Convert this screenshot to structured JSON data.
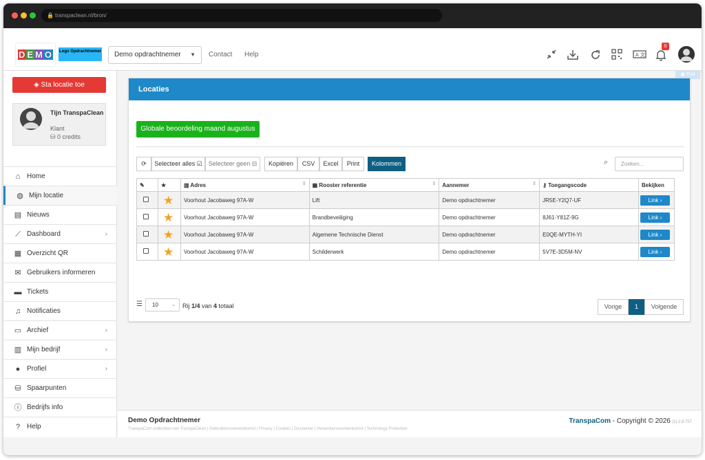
{
  "browser": {
    "url": "transpaclean.nl/bron/"
  },
  "header": {
    "logo_demo": "DEMO",
    "logo_opd": "Logo Opdrachtnemer",
    "company_select": "Demo opdrachtnemer",
    "nav": [
      "Contact",
      "Help"
    ],
    "notification_count": "0"
  },
  "sidebar": {
    "add_location_label": "Sta locatie toe",
    "profile": {
      "name": "Tijn TranspaClean",
      "role": "Klant",
      "credits": "0 credits"
    },
    "items": [
      {
        "label": "Home",
        "icon": "home-icon"
      },
      {
        "label": "Mijn locatie",
        "icon": "globe-icon"
      },
      {
        "label": "Nieuws",
        "icon": "news-icon"
      },
      {
        "label": "Dashboard",
        "icon": "chart-icon"
      },
      {
        "label": "Overzicht QR",
        "icon": "qr-icon"
      },
      {
        "label": "Gebruikers informeren",
        "icon": "envelope-icon"
      },
      {
        "label": "Tickets",
        "icon": "comment-icon"
      },
      {
        "label": "Notificaties",
        "icon": "bell-icon"
      },
      {
        "label": "Archief",
        "icon": "archive-icon"
      },
      {
        "label": "Mijn bedrijf",
        "icon": "building-icon"
      },
      {
        "label": "Profiel",
        "icon": "user-icon"
      },
      {
        "label": "Spaarpunten",
        "icon": "coins-icon"
      },
      {
        "label": "Bedrijfs info",
        "icon": "info-icon"
      },
      {
        "label": "Help",
        "icon": "help-icon"
      }
    ]
  },
  "tool_tab": "Tool",
  "panel": {
    "title": "Locaties",
    "global_button": "Globale beoordeling maand augustus",
    "toolbar": {
      "select_all": "Selecteer alles",
      "select_none": "Selecteer geen",
      "copy": "Kopiëren",
      "csv": "CSV",
      "excel": "Excel",
      "print": "Print",
      "columns": "Kolommen"
    },
    "search_placeholder": "Zoeken...",
    "columns": [
      "",
      "",
      "Adres",
      "Rooster referentie",
      "Aannemer",
      "Toegangscode",
      "Bekijken"
    ],
    "rows": [
      {
        "adres": "Voorhout Jacobaweg 97A-W",
        "rooster": "Lift",
        "aannemer": "Demo opdrachtnemer",
        "code": "JR5E-Y2Q7-UF",
        "link": "Link"
      },
      {
        "adres": "Voorhout Jacobaweg 97A-W",
        "rooster": "Brandbeveiliging",
        "aannemer": "Demo opdrachtnemer",
        "code": "8J61-Y81Z-9G",
        "link": "Link"
      },
      {
        "adres": "Voorhout Jacobaweg 97A-W",
        "rooster": "Algemene Technische Dienst",
        "aannemer": "Demo opdrachtnemer",
        "code": "E0QE-MYTH-YI",
        "link": "Link"
      },
      {
        "adres": "Voorhout Jacobaweg 97A-W",
        "rooster": "Schilderwerk",
        "aannemer": "Demo opdrachtnemer",
        "code": "5V7E-3D5M-NV",
        "link": "Link"
      }
    ],
    "page_size": "10",
    "info_pre": "Rij ",
    "info_range": "1/4",
    "info_mid": " van ",
    "info_total": "4",
    "info_post": " totaal",
    "pager": {
      "prev": "Vorige",
      "current": "1",
      "next": "Volgende"
    }
  },
  "footer": {
    "company": "Demo Opdrachtnemer",
    "links": "TranspaCom onderdeel van TranspaClean | Gebruikersovereenkomst | Privacy | Cookies | Disclaimer | Verwerkersovereenkomst | Technology Protection",
    "brand": "TranspaCom",
    "copyright": " - Copyright © 2026 ",
    "version": "[1] 2.8.757"
  },
  "colors": {
    "primary": "#1e88c8",
    "dark": "#0f5f83",
    "danger": "#e53935",
    "success": "#1ab21a",
    "star": "#f4a21d"
  }
}
